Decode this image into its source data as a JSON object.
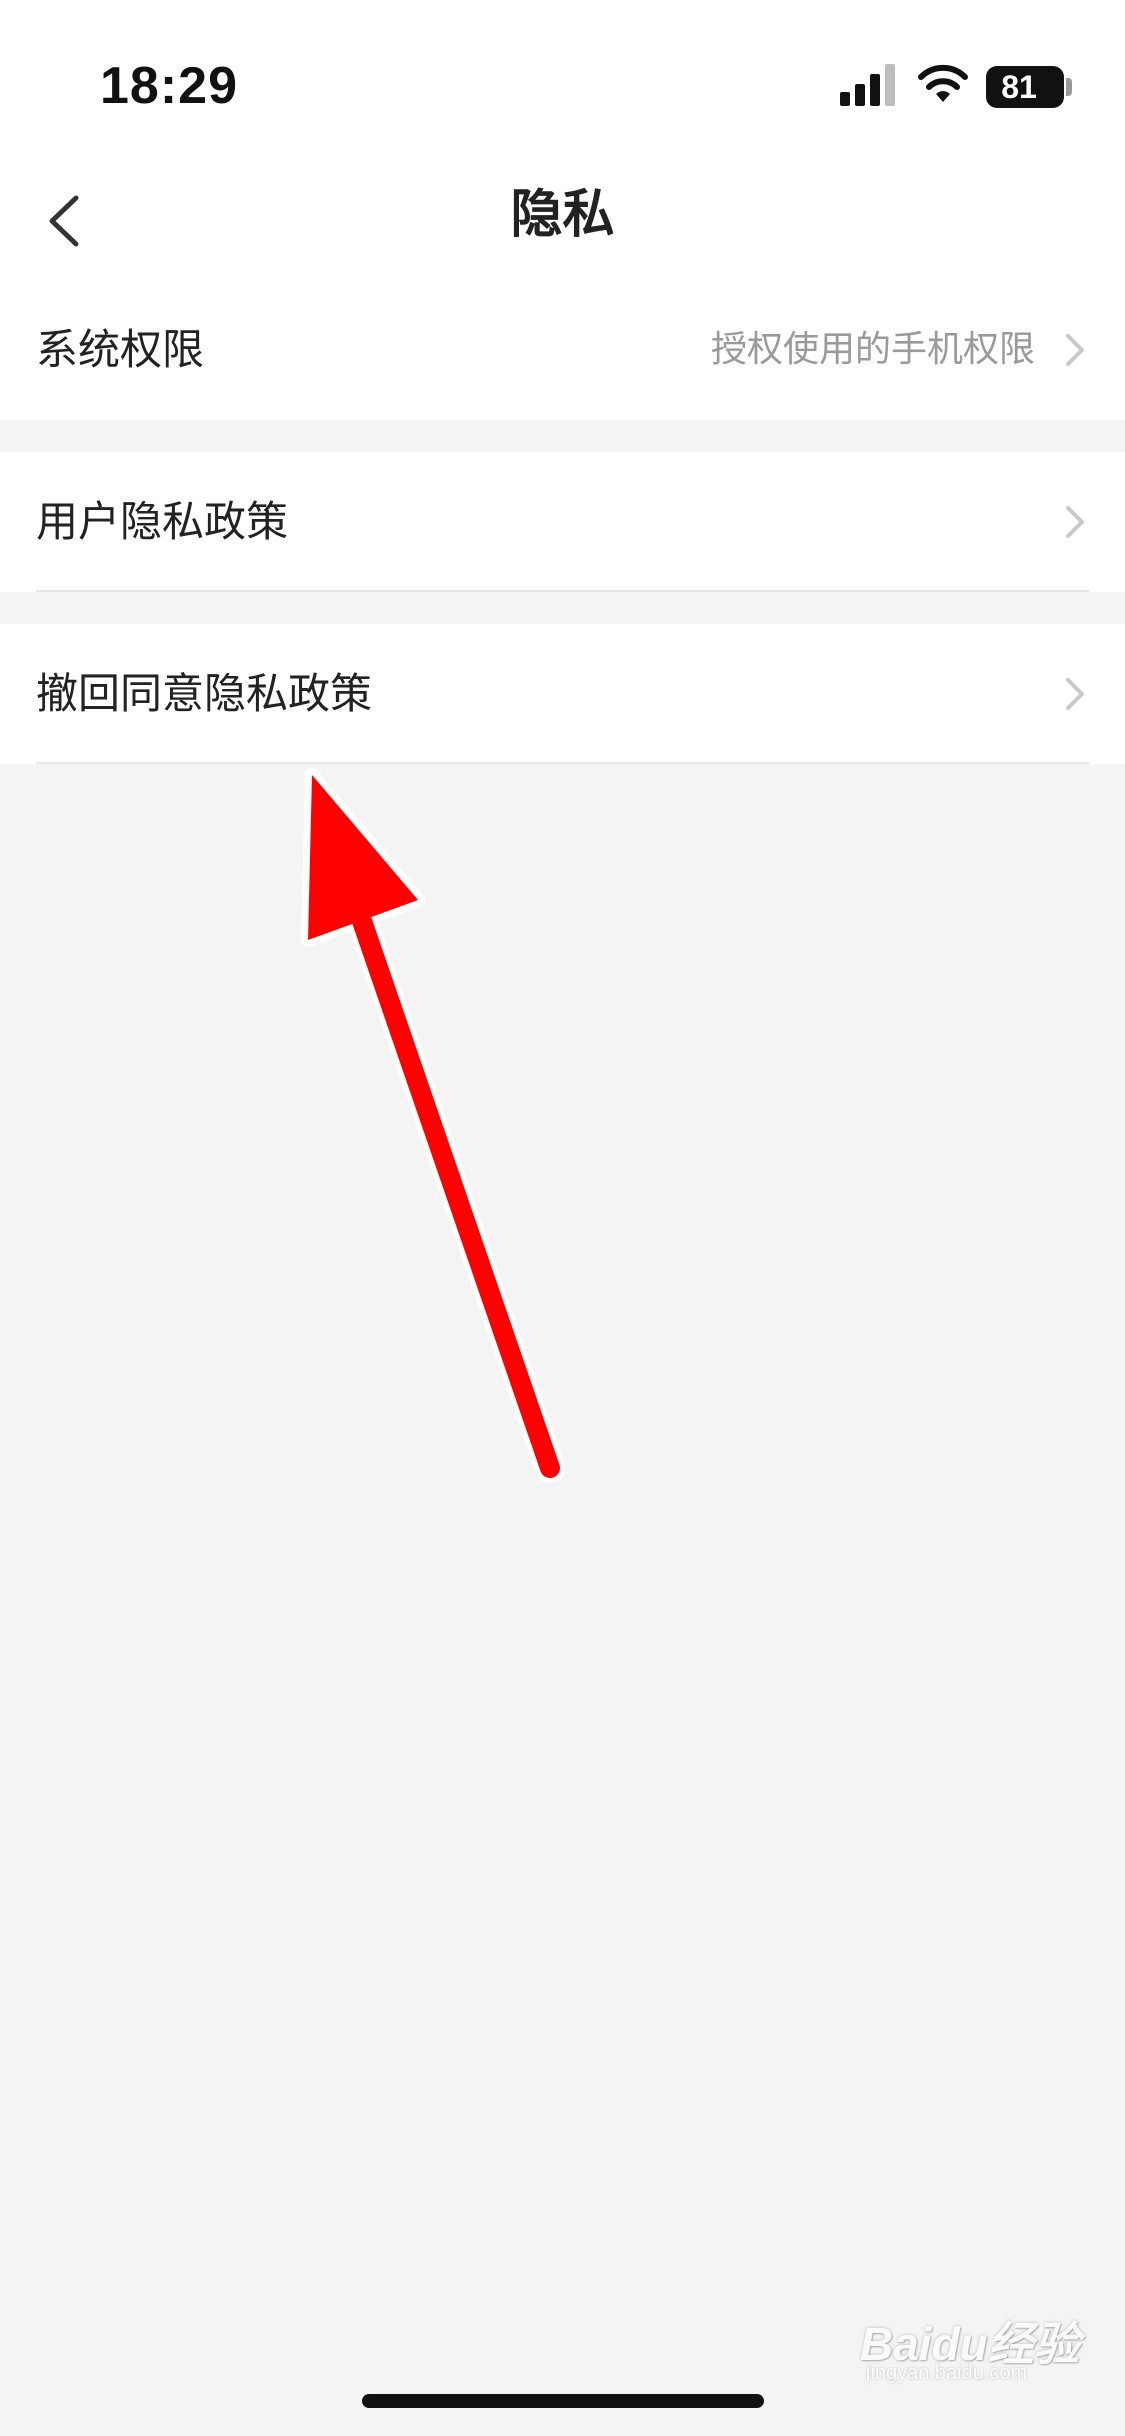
{
  "status_bar": {
    "time": "18:29",
    "battery": "81",
    "signal_icon": "cellular-signal-icon",
    "wifi_icon": "wifi-icon"
  },
  "nav": {
    "title": "隐私",
    "back_icon": "chevron-left-icon"
  },
  "list": [
    {
      "label": "系统权限",
      "detail": "授权使用的手机权限",
      "icon": "chevron-right-icon"
    },
    {
      "label": "用户隐私政策",
      "detail": "",
      "icon": "chevron-right-icon"
    },
    {
      "label": "撤回同意隐私政策",
      "detail": "",
      "icon": "chevron-right-icon"
    }
  ],
  "annotation": {
    "arrow_color": "#ff0000"
  },
  "watermark": {
    "logo": "Baidu经验",
    "url": "jingyan.baidu.com"
  },
  "colors": {
    "background": "#f4f4f4",
    "row_background": "#ffffff",
    "secondary_text": "#9a9a9a"
  }
}
